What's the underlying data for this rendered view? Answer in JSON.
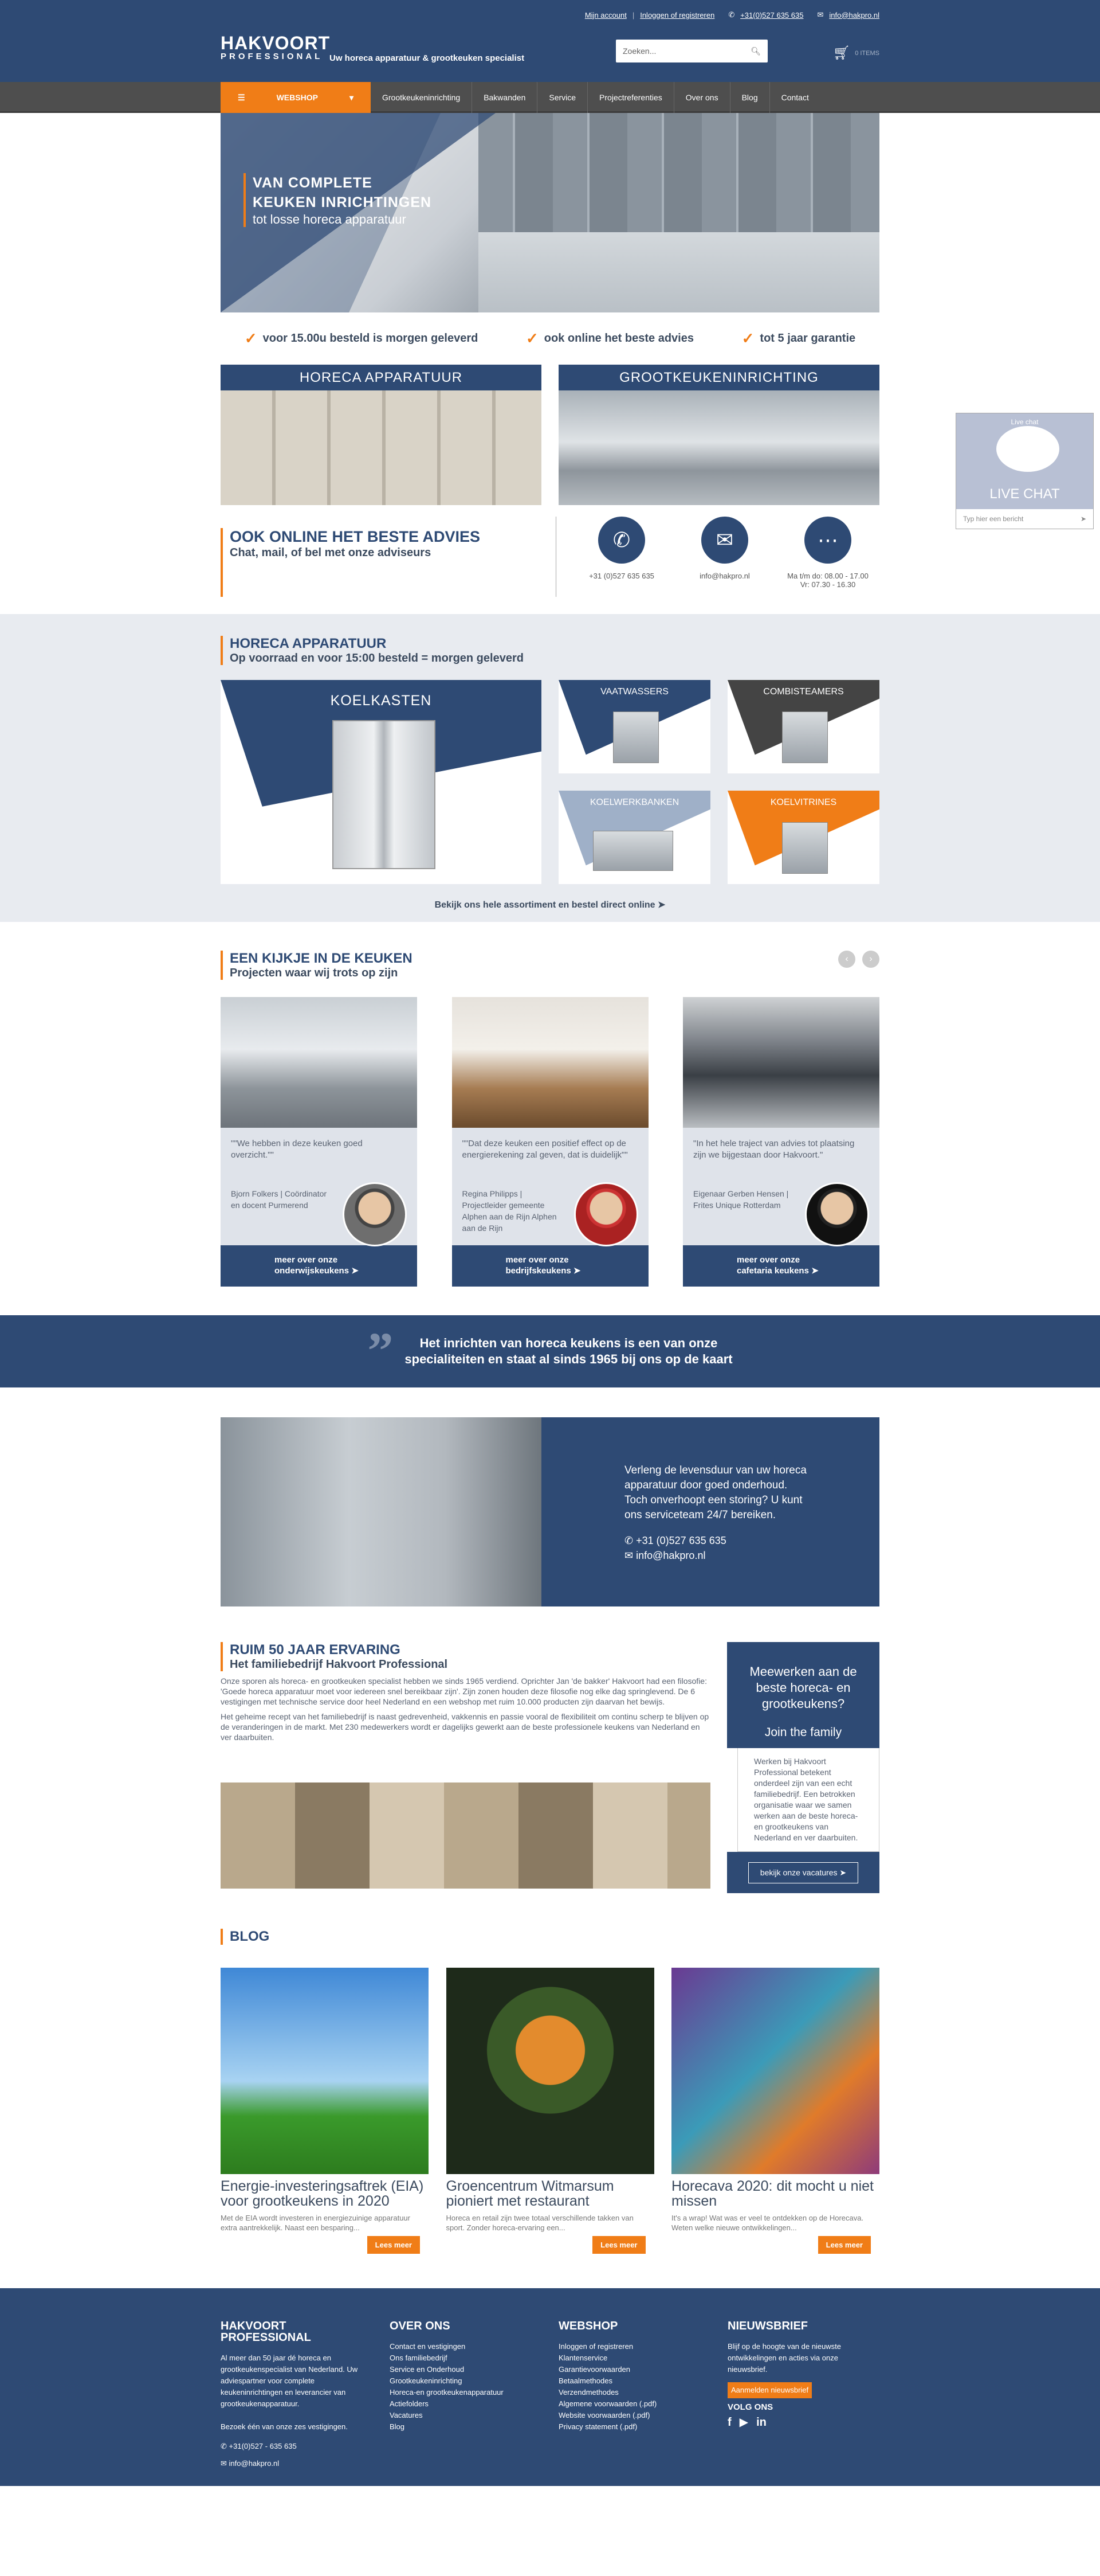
{
  "header": {
    "topbar": {
      "account": "Mijn account",
      "login": "Inloggen of registreren",
      "phone": "+31(0)527 635 635",
      "email": "info@hakpro.nl"
    },
    "logo_line1": "HAKVOORT",
    "logo_line2": "PROFESSIONAL",
    "tagline": "Uw horeca apparatuur & grootkeuken specialist",
    "search_placeholder": "Zoeken...",
    "cart_value": "0 ITEMS"
  },
  "nav": {
    "webshop": "WEBSHOP",
    "items": [
      "Grootkeukeninrichting",
      "Bakwanden",
      "Service",
      "Projectreferenties",
      "Over ons",
      "Blog",
      "Contact"
    ]
  },
  "hero": {
    "line1": "VAN COMPLETE",
    "line2": "KEUKEN INRICHTINGEN",
    "line3": "tot losse horeca apparatuur"
  },
  "usps": [
    "voor 15.00u besteld is morgen geleverd",
    "ook online het beste advies",
    "tot 5 jaar garantie"
  ],
  "tiles": [
    "HORECA APPARATUUR",
    "GROOTKEUKENINRICHTING"
  ],
  "advies": {
    "title": "OOK ONLINE HET BESTE ADVIES",
    "subtitle": "Chat, mail, of bel met onze adviseurs",
    "contacts": [
      {
        "icon": "phone-icon",
        "text": "+31 (0)527 635 635"
      },
      {
        "icon": "mail-icon",
        "text": "info@hakpro.nl"
      },
      {
        "icon": "chat-icon",
        "text": "Ma t/m do: 08.00 - 17.00 Vr: 07.30 - 16.30"
      }
    ]
  },
  "horeca": {
    "title": "HORECA APPARATUUR",
    "subtitle": "Op voorraad en voor 15:00 besteld = morgen geleverd",
    "big": "KOELKASTEN",
    "small": [
      "VAATWASSERS",
      "COMBISTEAMERS",
      "KOELWERKBANKEN",
      "KOELVITRINES"
    ],
    "more": "Bekijk ons hele assortiment en bestel direct online"
  },
  "keuken": {
    "title": "EEN KIJKJE IN DE KEUKEN",
    "subtitle": "Projecten waar wij trots op zijn",
    "projects": [
      {
        "quote": "\"\"We hebben in deze keuken goed overzicht.\"\"",
        "who": "Bjorn Folkers | Coördinator en docent Purmerend",
        "btn1": "meer over onze",
        "btn2": "onderwijskeukens"
      },
      {
        "quote": "\"\"Dat deze keuken een positief effect op de energierekening zal geven, dat is duidelijk\"\"",
        "who": "Regina Philipps | Projectleider gemeente Alphen aan de Rijn Alphen aan de Rijn",
        "btn1": "meer over onze",
        "btn2": "bedrijfskeukens"
      },
      {
        "quote": "\"In het hele traject van advies tot plaatsing zijn we bijgestaan door Hakvoort.\"",
        "who": "Eigenaar Gerben Hensen | Frites Unique Rotterdam",
        "btn1": "meer over onze",
        "btn2": "cafetaria keukens"
      }
    ]
  },
  "band": {
    "line1": "Het inrichten van horeca keukens is een van onze",
    "line2": "specialiteiten en staat al sinds 1965 bij ons op de kaart"
  },
  "service": {
    "text": "Verleng de levensduur van uw horeca apparatuur door goed onderhoud. Toch onverhoopt een storing? U kunt ons serviceteam 24/7 bereiken.",
    "phone": "+31 (0)527 635 635",
    "email": "info@hakpro.nl"
  },
  "ervaring": {
    "title": "RUIM 50 JAAR ERVARING",
    "subtitle": "Het familiebedrijf Hakvoort Professional",
    "p1": "Onze sporen als horeca- en grootkeuken specialist hebben we sinds 1965 verdiend. Oprichter Jan 'de bakker' Hakvoort had een filosofie: 'Goede horeca apparatuur moet voor iedereen snel bereikbaar zijn'. Zijn zonen houden deze filosofie nog elke dag springlevend. De 6 vestigingen met technische service door heel Nederland en een webshop met ruim 10.000 producten zijn daarvan het bewijs.",
    "p2": "Het geheime recept van het familiebedrijf is naast gedrevenheid, vakkennis en passie vooral de flexibiliteit om continu scherp te blijven op de veranderingen in de markt. Met 230 medewerkers wordt er dagelijks gewerkt aan de beste professionele keukens van Nederland en ver daarbuiten."
  },
  "join": {
    "title": "Meewerken aan de beste horeca- en grootkeukens?",
    "btn": "Join the family",
    "text": "Werken bij Hakvoort Professional betekent onderdeel zijn van een echt familiebedrijf. Een betrokken organisatie waar we samen werken aan de beste horeca- en grootkeukens van Nederland en ver daarbuiten.",
    "link": "bekijk onze vacatures"
  },
  "blog": {
    "title": "BLOG",
    "posts": [
      {
        "title": "Energie-investeringsaftrek (EIA) voor grootkeukens in 2020",
        "excerpt": "Met de EIA wordt investeren in energiezuinige apparatuur extra aantrekkelijk. Naast een besparing...",
        "btn": "Lees meer"
      },
      {
        "title": "Groencentrum Witmarsum pioniert met restaurant",
        "excerpt": "Horeca en retail zijn twee totaal verschillende takken van sport. Zonder horeca-ervaring een...",
        "btn": "Lees meer"
      },
      {
        "title": "Horecava 2020: dit mocht u niet missen",
        "excerpt": "It's a wrap! Wat was er veel te ontdekken op de Horecava. Weten welke nieuwe ontwikkelingen...",
        "btn": "Lees meer"
      }
    ]
  },
  "chat": {
    "header": "Live chat",
    "label": "LIVE CHAT",
    "placeholder": "Typ hier een bericht"
  },
  "footer": {
    "c1": {
      "title": "HAKVOORT PROFESSIONAL",
      "text": "Al meer dan 50 jaar dé horeca en grootkeukenspecialist van Nederland. Uw adviespartner voor complete keukeninrichtingen en leverancier van grootkeukenapparatuur.",
      "visit": "Bezoek één van onze zes vestigingen.",
      "phone": "+31(0)527 - 635 635",
      "email": "info@hakpro.nl"
    },
    "c2": {
      "title": "OVER ONS",
      "items": [
        "Contact en vestigingen",
        "Ons familiebedrijf",
        "Service en Onderhoud",
        "Grootkeukeninrichting",
        "Horeca-en grootkeukenapparatuur",
        "Actiefolders",
        "Vacatures",
        "Blog"
      ]
    },
    "c3": {
      "title": "WEBSHOP",
      "items": [
        "Inloggen of registreren",
        "Klantenservice",
        "Garantievoorwaarden",
        "Betaalmethodes",
        "Verzendmethodes",
        "Algemene voorwaarden (.pdf)",
        "Website voorwaarden (.pdf)",
        "Privacy statement (.pdf)"
      ]
    },
    "c4": {
      "title": "NIEUWSBRIEF",
      "text": "Blijf op de hoogte van de nieuwste ontwikkelingen en acties via onze nieuwsbrief.",
      "btn": "Aanmelden nieuwsbrief",
      "follow": "VOLG ONS"
    }
  }
}
